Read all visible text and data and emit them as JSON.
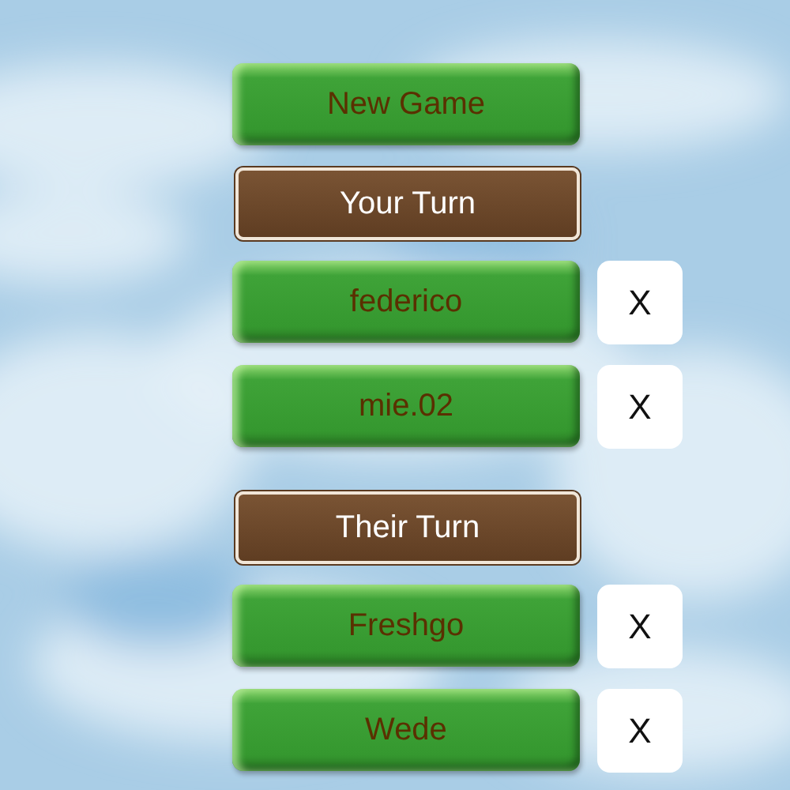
{
  "new_game_button": "New Game",
  "sections": [
    {
      "title": "Your Turn",
      "games": [
        {
          "opponent": "federico",
          "remove": "X"
        },
        {
          "opponent": "mie.02",
          "remove": "X"
        }
      ]
    },
    {
      "title": "Their Turn",
      "games": [
        {
          "opponent": "Freshgo",
          "remove": "X"
        },
        {
          "opponent": "Wede",
          "remove": "X"
        }
      ]
    }
  ]
}
